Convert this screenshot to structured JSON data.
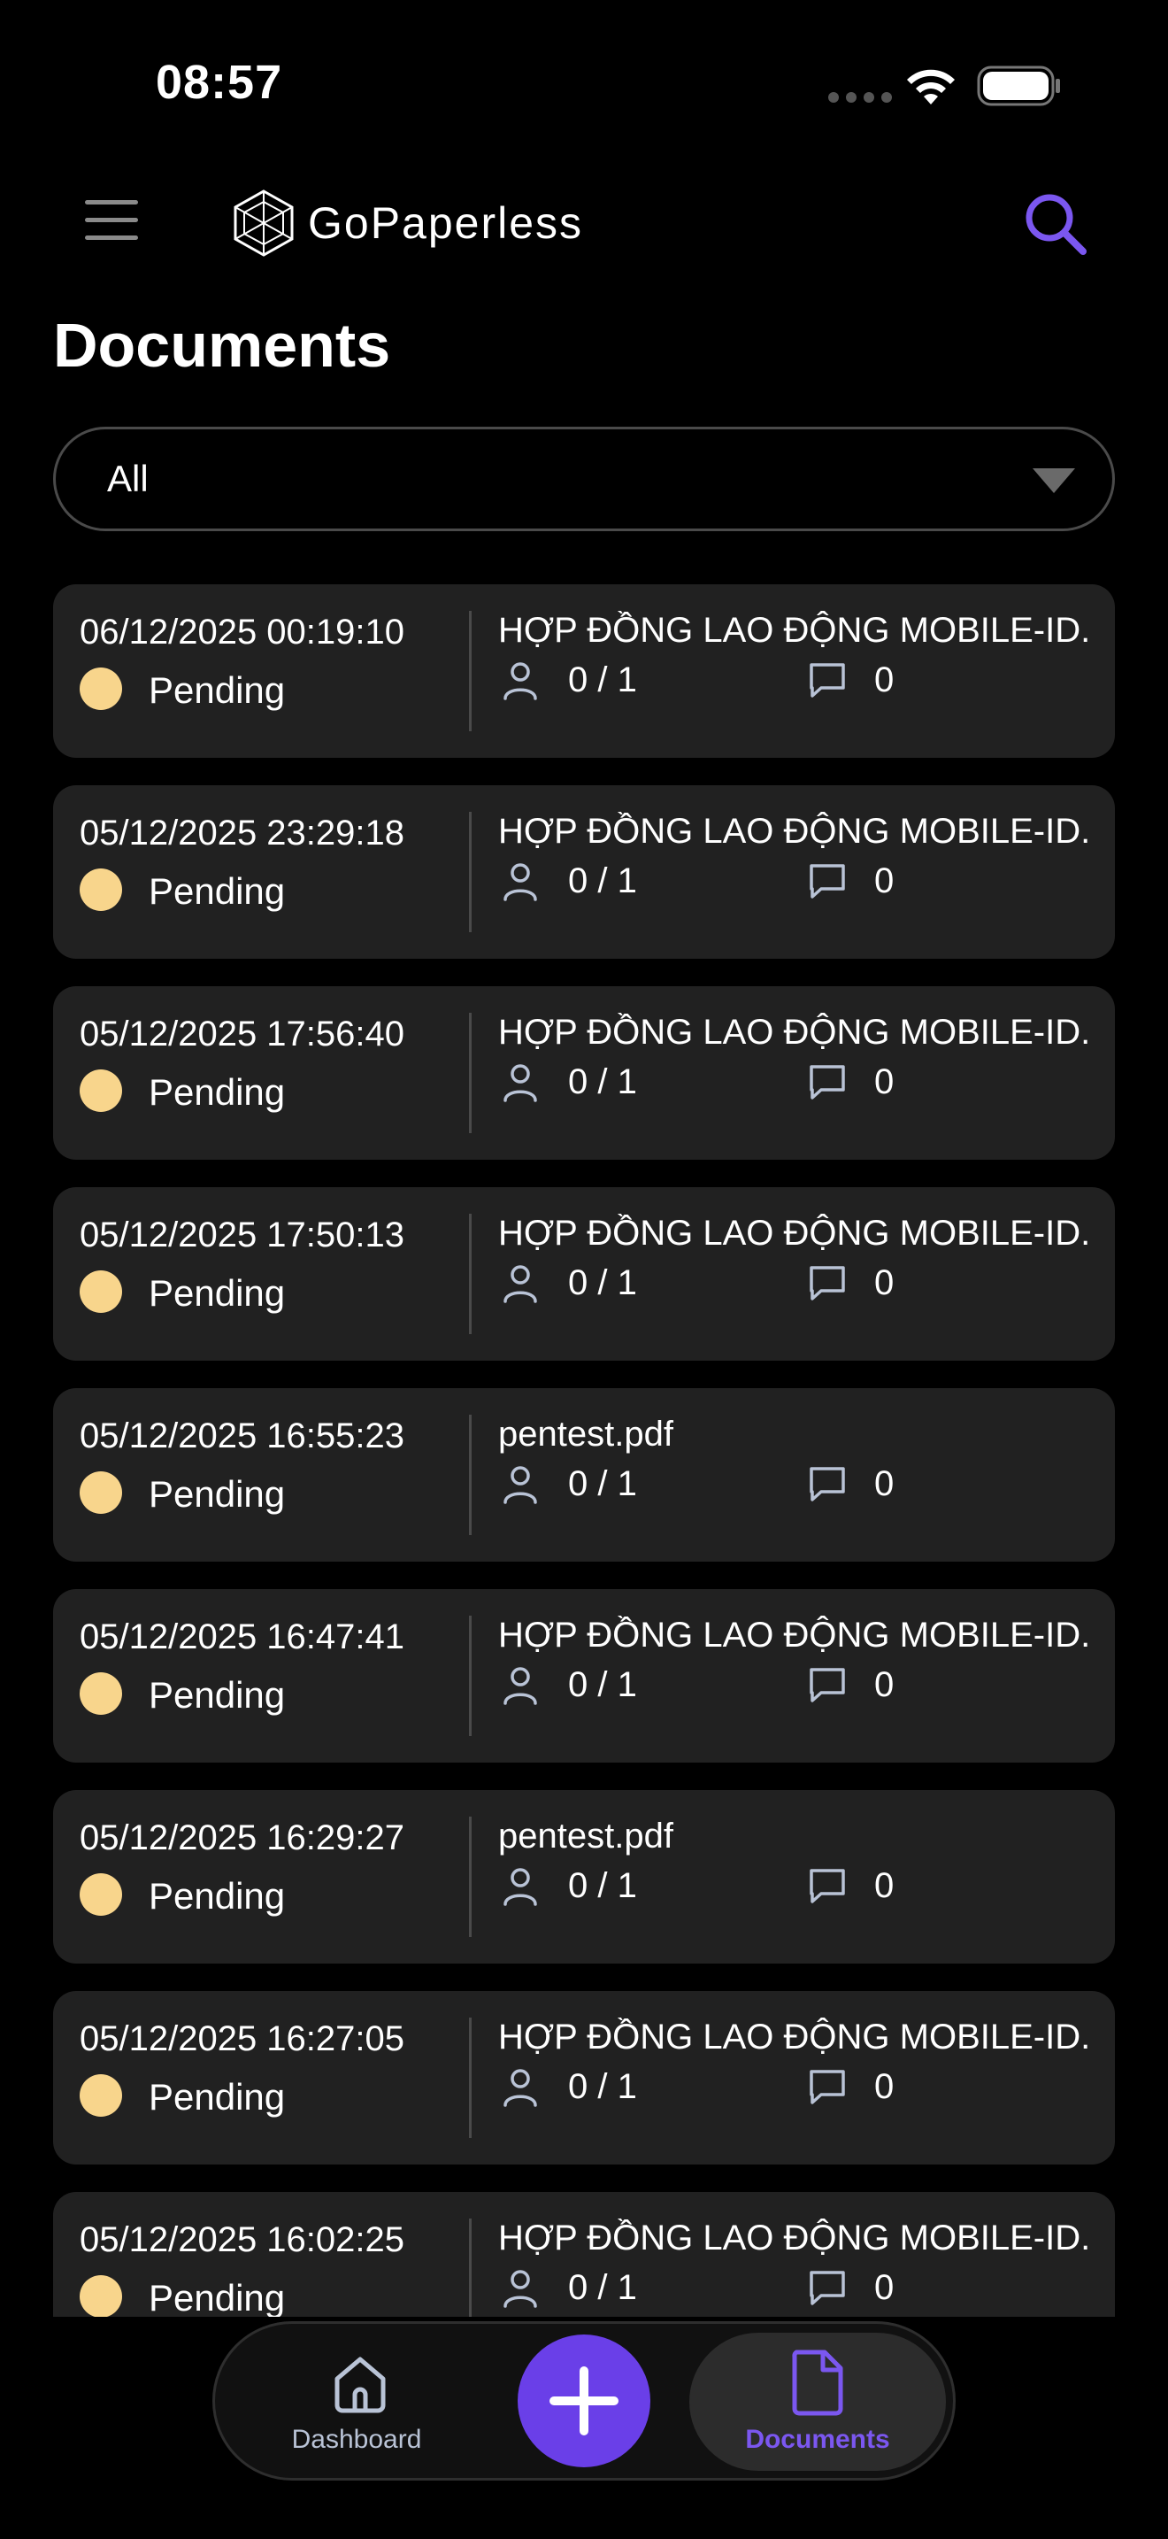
{
  "status_bar": {
    "time": "08:57"
  },
  "header": {
    "brand": "GoPaperless"
  },
  "page": {
    "title": "Documents"
  },
  "filter": {
    "selected": "All"
  },
  "documents": [
    {
      "date": "06/12/2025 00:19:10",
      "status": "Pending",
      "name": "HỢP ĐỒNG LAO ĐỘNG MOBILE-ID.pdf",
      "signers": "0 / 1",
      "comments": "0"
    },
    {
      "date": "05/12/2025 23:29:18",
      "status": "Pending",
      "name": "HỢP ĐỒNG LAO ĐỘNG MOBILE-ID.pdf",
      "signers": "0 / 1",
      "comments": "0"
    },
    {
      "date": "05/12/2025 17:56:40",
      "status": "Pending",
      "name": "HỢP ĐỒNG LAO ĐỘNG MOBILE-ID.pdf",
      "signers": "0 / 1",
      "comments": "0"
    },
    {
      "date": "05/12/2025 17:50:13",
      "status": "Pending",
      "name": "HỢP ĐỒNG LAO ĐỘNG MOBILE-ID.pdf",
      "signers": "0 / 1",
      "comments": "0"
    },
    {
      "date": "05/12/2025 16:55:23",
      "status": "Pending",
      "name": "pentest.pdf",
      "signers": "0 / 1",
      "comments": "0"
    },
    {
      "date": "05/12/2025 16:47:41",
      "status": "Pending",
      "name": "HỢP ĐỒNG LAO ĐỘNG MOBILE-ID.pdf",
      "signers": "0 / 1",
      "comments": "0"
    },
    {
      "date": "05/12/2025 16:29:27",
      "status": "Pending",
      "name": "pentest.pdf",
      "signers": "0 / 1",
      "comments": "0"
    },
    {
      "date": "05/12/2025 16:27:05",
      "status": "Pending",
      "name": "HỢP ĐỒNG LAO ĐỘNG MOBILE-ID.pdf",
      "signers": "0 / 1",
      "comments": "0"
    },
    {
      "date": "05/12/2025 16:02:25",
      "status": "Pending",
      "name": "HỢP ĐỒNG LAO ĐỘNG MOBILE-ID.pdf",
      "signers": "0 / 1",
      "comments": "0"
    }
  ],
  "bottom_nav": {
    "dashboard_label": "Dashboard",
    "documents_label": "Documents"
  },
  "colors": {
    "accent": "#6a3fe8",
    "status_pending": "#f8d58c",
    "card_bg": "#212121"
  },
  "icons": {
    "menu": "hamburger-icon",
    "search": "search-icon",
    "status": "pending-icon",
    "signers": "person-icon",
    "comments": "comment-icon",
    "dashboard": "home-icon",
    "add": "plus-icon",
    "documents": "document-icon"
  }
}
